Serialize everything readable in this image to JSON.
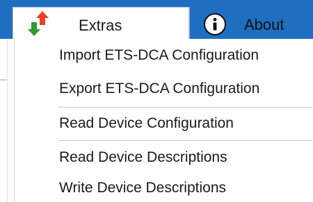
{
  "tabs": {
    "extras": {
      "label": "Extras",
      "icon": "arrows-up-down-icon"
    },
    "about": {
      "label": "About",
      "icon": "info-icon"
    }
  },
  "menu": {
    "items": [
      {
        "label": "Import ETS-DCA Configuration"
      },
      {
        "label": "Export ETS-DCA Configuration"
      },
      {
        "label": "Read Device Configuration"
      },
      {
        "label": "Read Device Descriptions"
      },
      {
        "label": "Write Device Descriptions"
      }
    ]
  },
  "colors": {
    "ribbon": "#1f6fc0",
    "arrow_up": "#e8402f",
    "arrow_down": "#2e9a35"
  }
}
